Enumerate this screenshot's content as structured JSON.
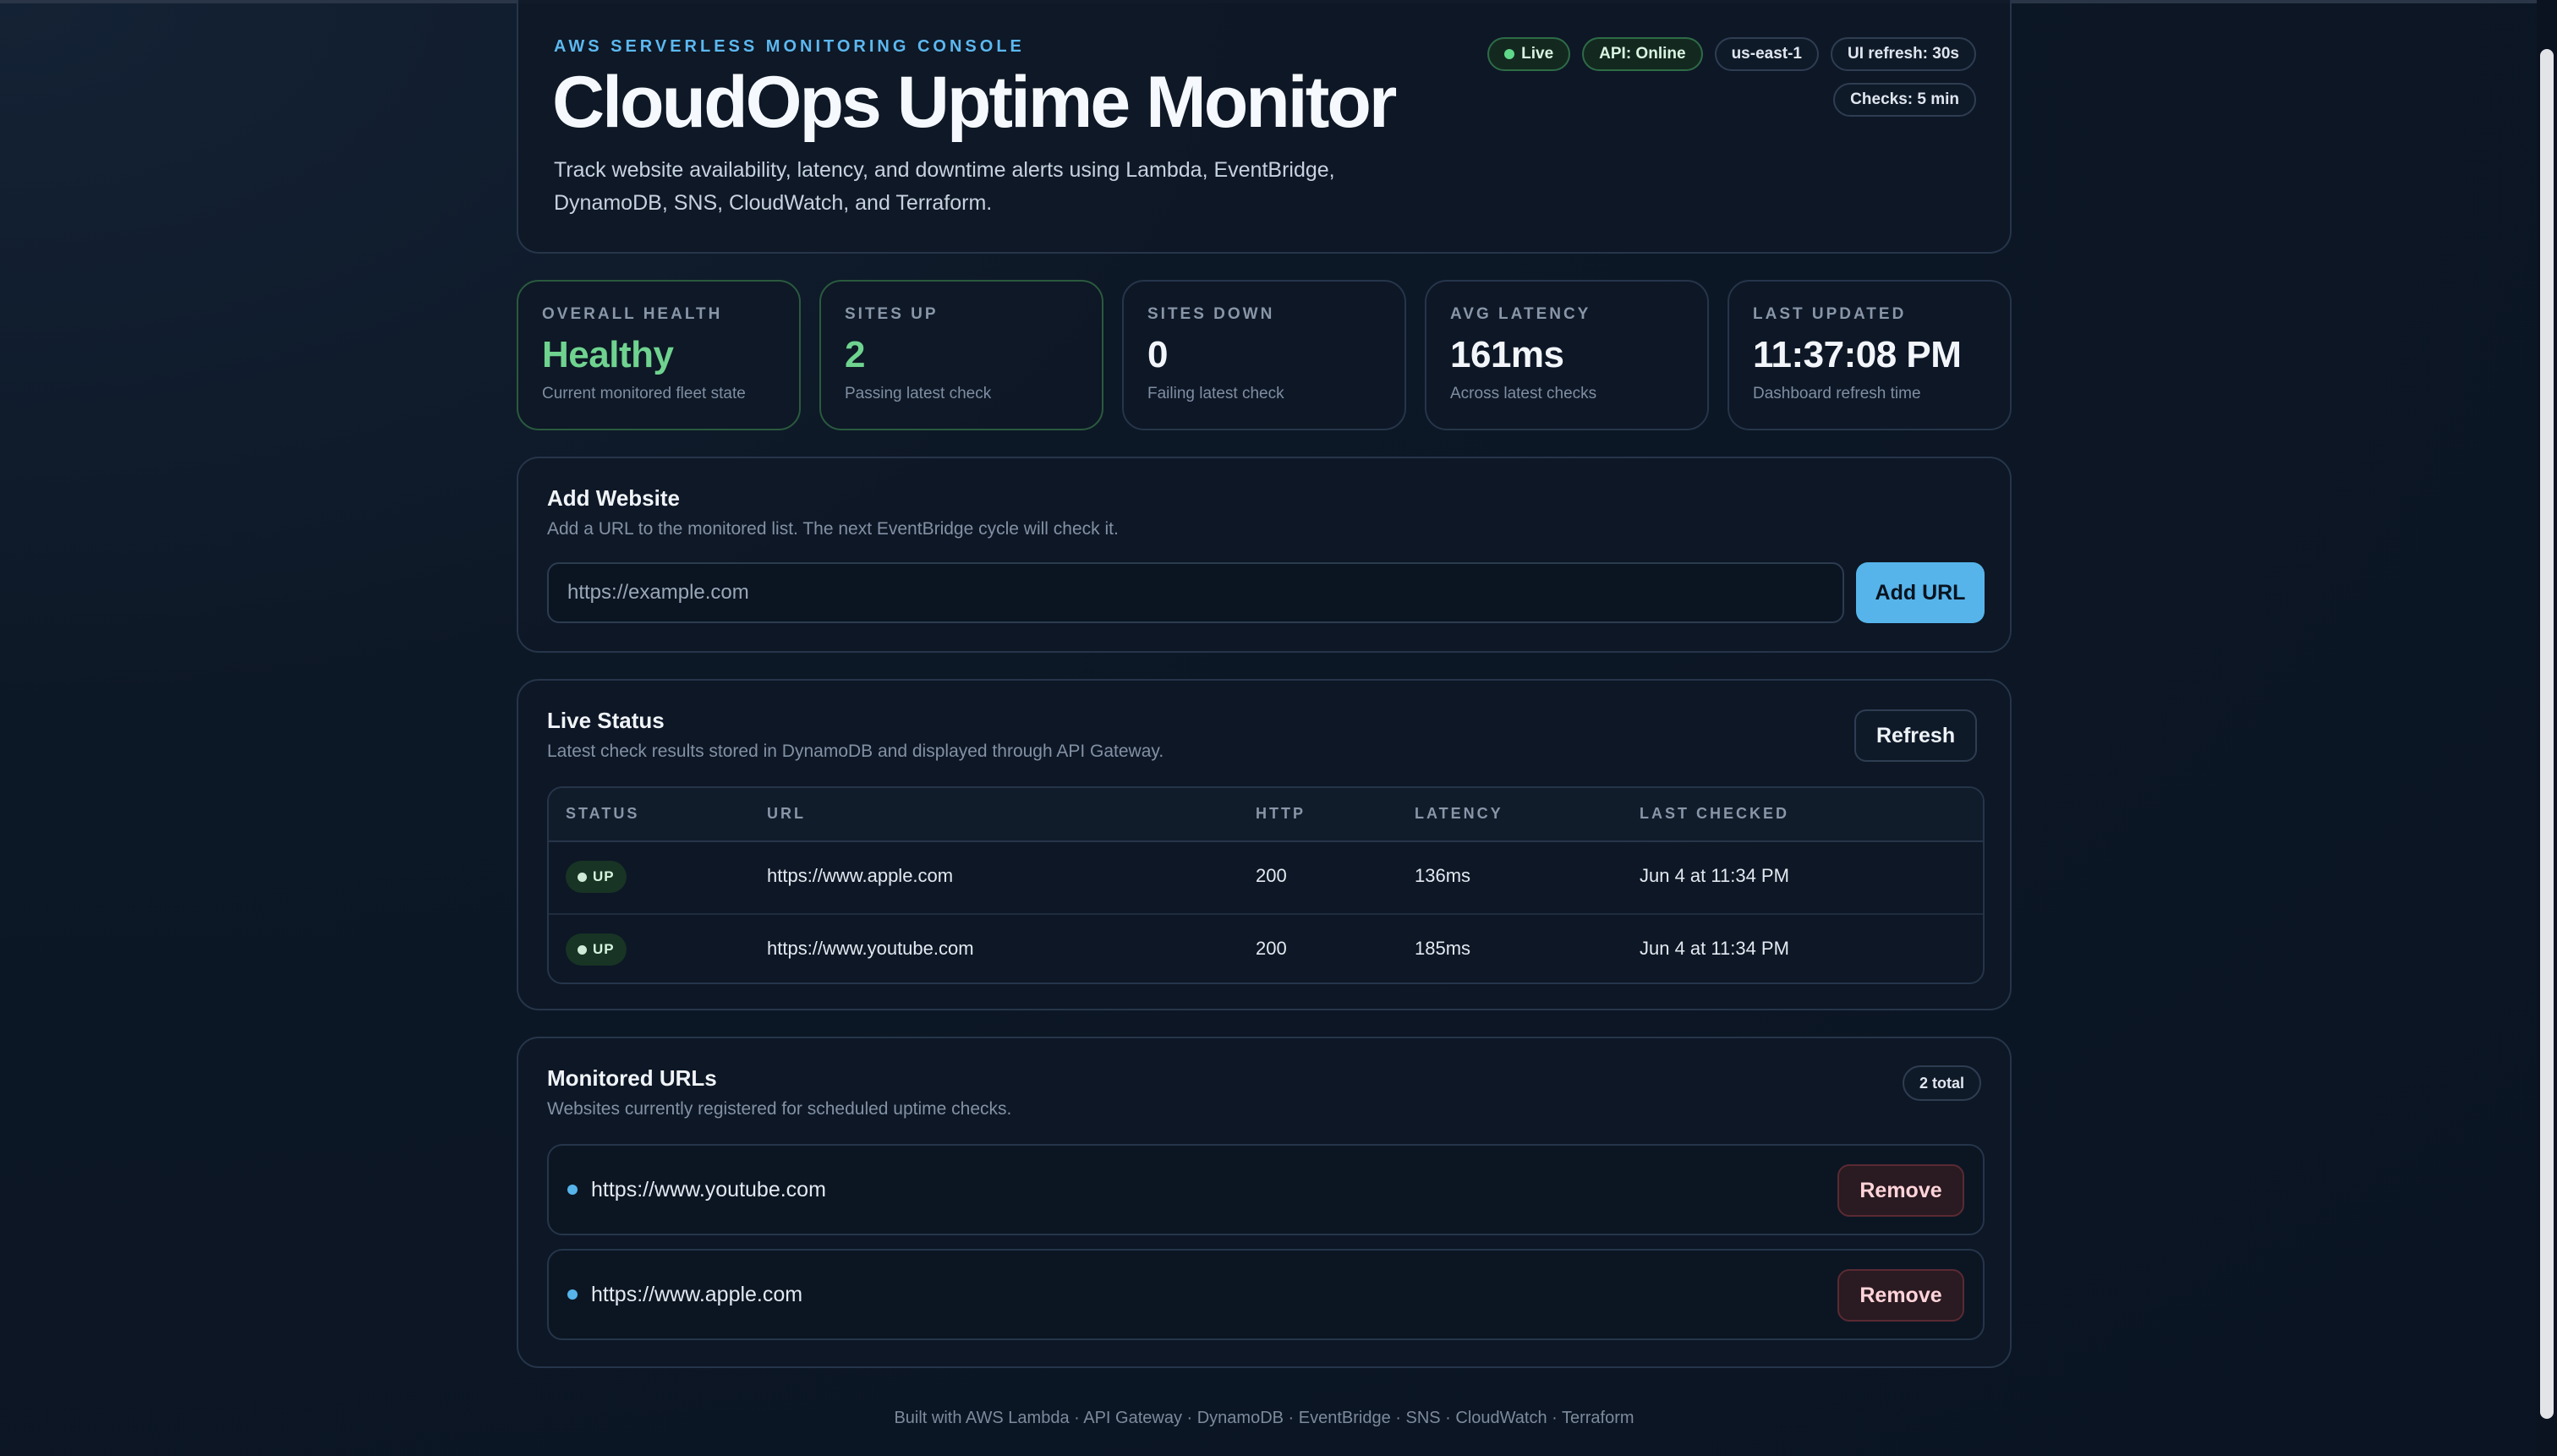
{
  "hero": {
    "eyebrow": "AWS Serverless Monitoring Console",
    "title": "CloudOps Uptime Monitor",
    "description": "Track website availability, latency, and downtime alerts using Lambda, EventBridge, DynamoDB, SNS, CloudWatch, and Terraform.",
    "pills": {
      "live": "Live",
      "api": "API: Online",
      "region": "us-east-1",
      "ui_refresh": "UI refresh: 30s",
      "checks": "Checks: 5 min"
    }
  },
  "stats": [
    {
      "label": "Overall Health",
      "value": "Healthy",
      "sub": "Current monitored fleet state"
    },
    {
      "label": "Sites Up",
      "value": "2",
      "sub": "Passing latest check"
    },
    {
      "label": "Sites Down",
      "value": "0",
      "sub": "Failing latest check"
    },
    {
      "label": "Avg Latency",
      "value": "161ms",
      "sub": "Across latest checks"
    },
    {
      "label": "Last Updated",
      "value": "11:37:08 PM",
      "sub": "Dashboard refresh time"
    }
  ],
  "add_website": {
    "title": "Add Website",
    "subtitle": "Add a URL to the monitored list. The next EventBridge cycle will check it.",
    "input_value": "",
    "placeholder": "https://example.com",
    "button": "Add URL"
  },
  "live_status": {
    "title": "Live Status",
    "subtitle": "Latest check results stored in DynamoDB and displayed through API Gateway.",
    "refresh_button": "Refresh",
    "columns": [
      "Status",
      "URL",
      "HTTP",
      "Latency",
      "Last Checked"
    ],
    "rows": [
      {
        "status": "UP",
        "url": "https://www.apple.com",
        "http": "200",
        "latency": "136ms",
        "last_checked": "Jun 4 at 11:34 PM"
      },
      {
        "status": "UP",
        "url": "https://www.youtube.com",
        "http": "200",
        "latency": "185ms",
        "last_checked": "Jun 4 at 11:34 PM"
      }
    ]
  },
  "monitored": {
    "title": "Monitored URLs",
    "subtitle": "Websites currently registered for scheduled uptime checks.",
    "count": "2 total",
    "items": [
      {
        "url": "https://www.youtube.com",
        "remove": "Remove"
      },
      {
        "url": "https://www.apple.com",
        "remove": "Remove"
      }
    ]
  },
  "footer": "Built with AWS Lambda · API Gateway · DynamoDB · EventBridge · SNS · CloudWatch · Terraform",
  "colors": {
    "accent": "#56b4ea",
    "success": "#6fd38f",
    "danger_text": "#ffd4d9",
    "background": "#0a1422"
  },
  "icons": {
    "live_indicator": "green-dot-icon",
    "status_indicator": "status-dot-icon",
    "list_bullet": "bullet-dot-icon"
  }
}
